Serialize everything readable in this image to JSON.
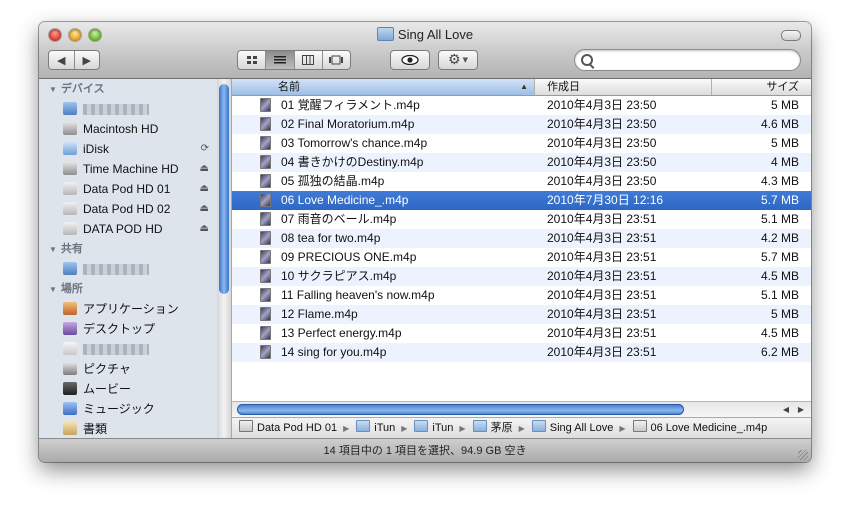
{
  "window": {
    "title": "Sing All Love"
  },
  "toolbar": {
    "back_icon": "◀",
    "forward_icon": "▶",
    "view_modes": [
      "icon-view",
      "list-view",
      "column-view",
      "cover-flow"
    ],
    "active_view": "list-view",
    "quicklook_icon": "eye-icon",
    "action_icon": "gear-icon",
    "search_placeholder": ""
  },
  "sidebar": {
    "sections": [
      {
        "label": "デバイス",
        "items": [
          {
            "label": "",
            "icon": "computer-icon",
            "blurred": true
          },
          {
            "label": "Macintosh HD",
            "icon": "hard-disk-icon"
          },
          {
            "label": "iDisk",
            "icon": "idisk-icon",
            "sync": "⟳"
          },
          {
            "label": "Time Machine HD",
            "icon": "hard-disk-icon",
            "eject": "⏏"
          },
          {
            "label": "Data Pod HD 01",
            "icon": "external-disk-icon",
            "eject": "⏏"
          },
          {
            "label": "Data Pod HD 02",
            "icon": "external-disk-icon",
            "eject": "⏏"
          },
          {
            "label": "DATA POD HD",
            "icon": "external-disk-icon",
            "eject": "⏏"
          }
        ]
      },
      {
        "label": "共有",
        "items": [
          {
            "label": "",
            "icon": "network-computer-icon",
            "blurred": true
          }
        ]
      },
      {
        "label": "場所",
        "items": [
          {
            "label": "アプリケーション",
            "icon": "applications-icon"
          },
          {
            "label": "デスクトップ",
            "icon": "desktop-icon"
          },
          {
            "label": "",
            "icon": "home-icon",
            "blurred": true
          },
          {
            "label": "ピクチャ",
            "icon": "pictures-icon"
          },
          {
            "label": "ムービー",
            "icon": "movies-icon"
          },
          {
            "label": "ミュージック",
            "icon": "music-icon"
          },
          {
            "label": "書類",
            "icon": "documents-icon"
          }
        ]
      }
    ]
  },
  "list": {
    "columns": {
      "name": "名前",
      "date": "作成日",
      "size": "サイズ"
    },
    "sort_indicator": "▲",
    "rows": [
      {
        "name": "01 覚醒フィラメント.m4p",
        "date": "2010年4月3日 23:50",
        "size": "5 MB"
      },
      {
        "name": "02 Final Moratorium.m4p",
        "date": "2010年4月3日 23:50",
        "size": "4.6 MB"
      },
      {
        "name": "03 Tomorrow's chance.m4p",
        "date": "2010年4月3日 23:50",
        "size": "5 MB"
      },
      {
        "name": "04 書きかけのDestiny.m4p",
        "date": "2010年4月3日 23:50",
        "size": "4 MB"
      },
      {
        "name": "05 孤独の結晶.m4p",
        "date": "2010年4月3日 23:50",
        "size": "4.3 MB"
      },
      {
        "name": "06 Love Medicine_.m4p",
        "date": "2010年7月30日 12:16",
        "size": "5.7 MB",
        "selected": true
      },
      {
        "name": "07 雨音のベール.m4p",
        "date": "2010年4月3日 23:51",
        "size": "5.1 MB"
      },
      {
        "name": "08 tea for two.m4p",
        "date": "2010年4月3日 23:51",
        "size": "4.2 MB"
      },
      {
        "name": "09 PRECIOUS ONE.m4p",
        "date": "2010年4月3日 23:51",
        "size": "5.7 MB"
      },
      {
        "name": "10 サクラピアス.m4p",
        "date": "2010年4月3日 23:51",
        "size": "4.5 MB"
      },
      {
        "name": "11 Falling heaven's now.m4p",
        "date": "2010年4月3日 23:51",
        "size": "5.1 MB"
      },
      {
        "name": "12 Flame.m4p",
        "date": "2010年4月3日 23:51",
        "size": "5 MB"
      },
      {
        "name": "13 Perfect energy.m4p",
        "date": "2010年4月3日 23:51",
        "size": "4.5 MB"
      },
      {
        "name": "14 sing for you.m4p",
        "date": "2010年4月3日 23:51",
        "size": "6.2 MB"
      }
    ]
  },
  "pathbar": [
    {
      "label": "Data Pod HD 01",
      "type": "disk"
    },
    {
      "label": "iTun",
      "type": "folder"
    },
    {
      "label": "iTun",
      "type": "folder"
    },
    {
      "label": "茅原",
      "type": "folder"
    },
    {
      "label": "Sing All Love",
      "type": "folder"
    },
    {
      "label": "06 Love Medicine_.m4p",
      "type": "file"
    }
  ],
  "status": "14 項目中の 1 項目を選択、94.9 GB 空き",
  "colors": {
    "selection": "#3a74d1",
    "row_alt": "#edf3fe",
    "sidebar_bg": "#dde4ec"
  }
}
